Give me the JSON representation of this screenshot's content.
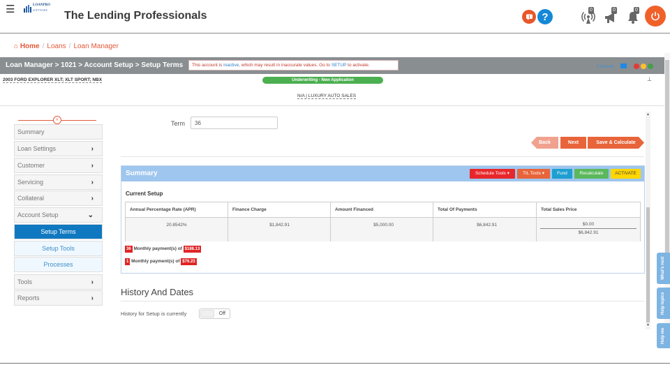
{
  "header": {
    "logo_line1": "LOANPRO",
    "logo_line2": "SOFTWARE",
    "app_title": "The Lending Professionals",
    "notifications": [
      {
        "icon": "broadcast-icon",
        "count": "0"
      },
      {
        "icon": "megaphone-icon",
        "count": "0"
      },
      {
        "icon": "bell-icon",
        "count": "0"
      }
    ]
  },
  "breadcrumb": {
    "home": "Home",
    "items": [
      "Loans",
      "Loan Manager"
    ]
  },
  "titlebar": {
    "path": "Loan Manager > 1021 > Account Setup > Setup Terms",
    "alert_part1": "This account is ",
    "alert_link1": "inactive",
    "alert_part2": ", which may result in inaccurate values. Go to ",
    "alert_link2": "SETUP",
    "alert_part3": " to activate.",
    "evaluate": "Evaluate",
    "dots": [
      "#e53935",
      "#fbc02d",
      "#43a047"
    ]
  },
  "loan_info": {
    "vehicle": "2003 FORD EXPLORER XLT; XLT SPORT; NBX",
    "status": "Underwriting - New Application",
    "dealer": "N/A | LUXURY AUTO SALES"
  },
  "sidebar": {
    "collapse": "«",
    "items": [
      {
        "label": "Summary",
        "chevron": ""
      },
      {
        "label": "Loan Settings",
        "chevron": "›"
      },
      {
        "label": "Customer",
        "chevron": "›"
      },
      {
        "label": "Servicing",
        "chevron": "›"
      },
      {
        "label": "Collateral",
        "chevron": "›"
      },
      {
        "label": "Account Setup",
        "chevron": "⌄"
      },
      {
        "label": "Tools",
        "chevron": "›"
      },
      {
        "label": "Reports",
        "chevron": "›"
      }
    ],
    "subitems": [
      {
        "label": "Setup Terms",
        "active": true
      },
      {
        "label": "Setup Tools",
        "active": false
      },
      {
        "label": "Processes",
        "active": false
      }
    ]
  },
  "form": {
    "term_label": "Term",
    "term_value": "36"
  },
  "nav_buttons": {
    "back": "Back",
    "next": "Next",
    "save": "Save & Calculate"
  },
  "summary": {
    "title": "Summary",
    "tools": [
      {
        "label": "Schedule Tools ▾",
        "color": "#e8272b"
      },
      {
        "label": "TIL Tools ▾",
        "color": "#e8643a"
      },
      {
        "label": "Fund",
        "color": "#1e9fd0"
      },
      {
        "label": "Recalculate",
        "color": "#5cb85c"
      },
      {
        "label": "ACTIVATE",
        "color": "#ffd600"
      }
    ],
    "current_setup": "Current Setup",
    "columns": [
      "Annual Percentage Rate (APR)",
      "Finance Charge",
      "Amount Financed",
      "Total Of Payments",
      "Total Sales Price"
    ],
    "values": [
      "20.8542%",
      "$1,842.91",
      "$5,000.00",
      "$6,842.91",
      "$0.00"
    ],
    "sales_price_total": "$6,842.91",
    "payments": [
      {
        "count": "36",
        "text": " Monthly payment(s) of ",
        "amount": "$188.13"
      },
      {
        "count": "1",
        "text": " Monthly payment(s) of ",
        "amount": "$76.23"
      }
    ]
  },
  "history": {
    "title": "History And Dates",
    "text": "History for Setup is currently",
    "toggle": "Off"
  },
  "side_tabs": [
    "What's next",
    "Help topics",
    "Help me"
  ]
}
